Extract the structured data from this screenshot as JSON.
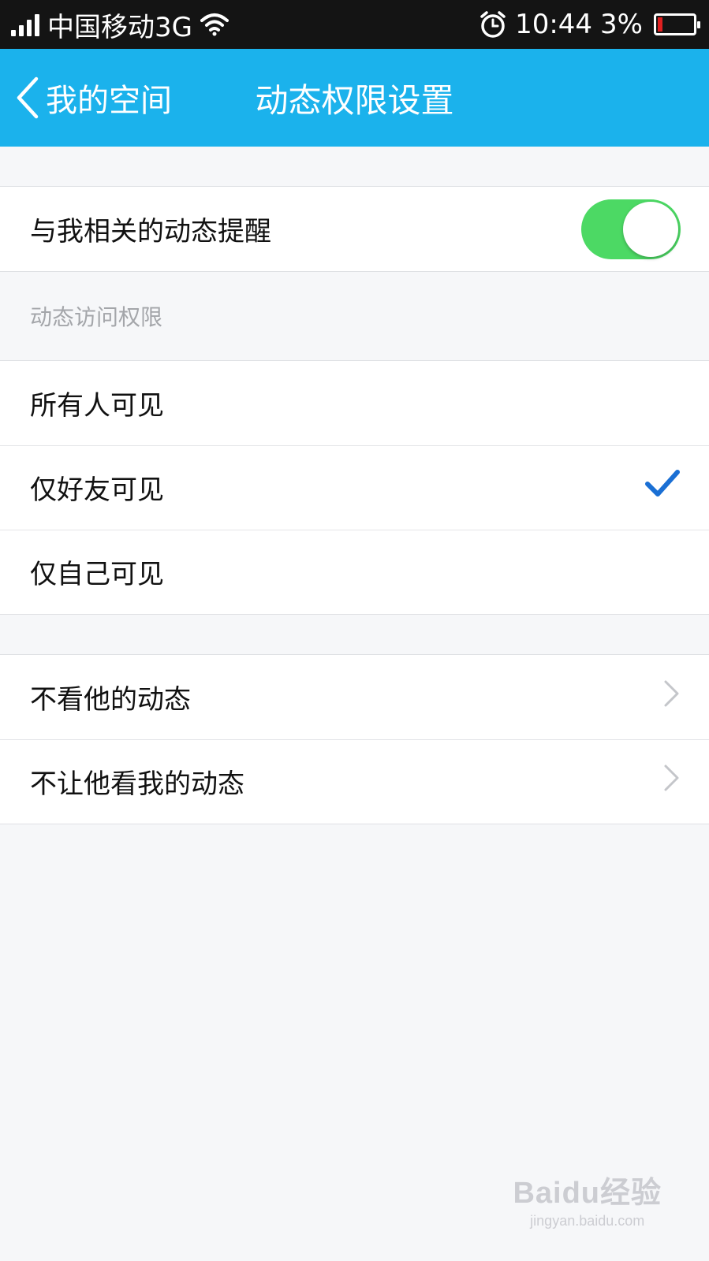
{
  "status_bar": {
    "carrier": "中国移动3G",
    "time": "10:44",
    "battery": "3%"
  },
  "nav": {
    "back_label": "我的空间",
    "title": "动态权限设置"
  },
  "notify": {
    "label": "与我相关的动态提醒",
    "enabled": true
  },
  "access": {
    "section_label": "动态访问权限",
    "options": [
      {
        "label": "所有人可见",
        "selected": false
      },
      {
        "label": "仅好友可见",
        "selected": true
      },
      {
        "label": "仅自己可见",
        "selected": false
      }
    ]
  },
  "blocking": {
    "items": [
      {
        "label": "不看他的动态"
      },
      {
        "label": "不让他看我的动态"
      }
    ]
  },
  "watermark": {
    "logo": "Baidu经验",
    "url": "jingyan.baidu.com"
  },
  "colors": {
    "nav_bar": "#1bb2ec",
    "toggle_on": "#4cd964",
    "check": "#1a6fd4"
  }
}
